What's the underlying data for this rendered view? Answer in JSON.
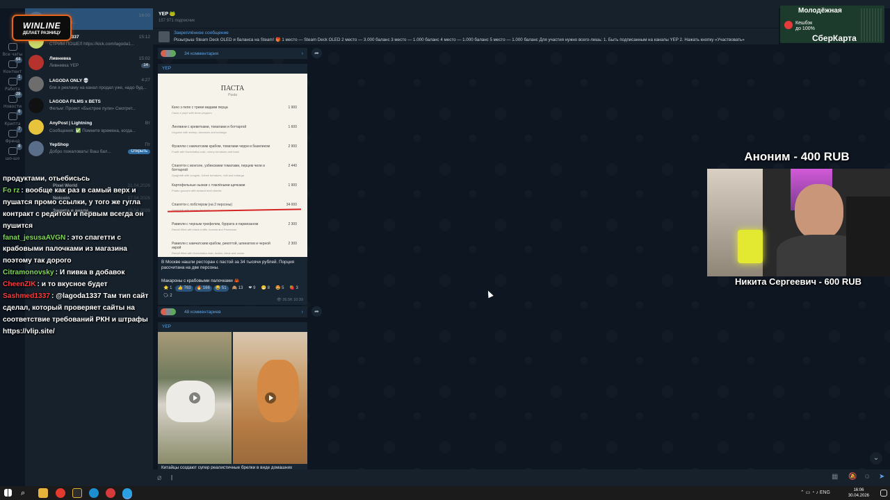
{
  "top_strip": {
    "bg": "#17212b"
  },
  "folders": [
    {
      "label": "Все чаты",
      "badge": ""
    },
    {
      "label": "Контент",
      "badge": "64"
    },
    {
      "label": "Работа",
      "badge": "1"
    },
    {
      "label": "Новости",
      "badge": "28"
    },
    {
      "label": "Крипта",
      "badge": "6"
    },
    {
      "label": "Френд",
      "badge": "7"
    },
    {
      "label": "шо-шо",
      "badge": "8"
    }
  ],
  "ad_logo": {
    "brand": "WINLINE",
    "slogan": "ДЕЛАЕТ РАЗНИЦУ"
  },
  "chats": [
    {
      "name": "",
      "preview": "Челленджи...",
      "time": "16:00",
      "badge": "",
      "active": true,
      "avatar_color": "#3d6fa0"
    },
    {
      "name": "LAGODA1337",
      "preview": "СТРИМ ПОШЕЛ https://kick.com/lagoda1...",
      "time": "15:12",
      "badge": "",
      "active": false,
      "avatar_color": "#c7d86a"
    },
    {
      "name": "Ливневка",
      "preview": "Ливневка YEP",
      "time": "15:02",
      "badge": "14",
      "active": false,
      "avatar_color": "#b5332c"
    },
    {
      "name": "LAGODA ONLY 💀",
      "preview": "бля я рекламу на канал продал уже, надо буд...",
      "time": "4:27",
      "badge": "",
      "active": false,
      "avatar_color": "#6d6d6d"
    },
    {
      "name": "LAGODA FILMS x BETS",
      "preview": "Фильм: Проект «Быстрее пули» Смотрет...",
      "time": "",
      "badge": "",
      "active": false,
      "avatar_color": "#111111"
    },
    {
      "name": "AnyPost | Lightning",
      "preview": "Сообщения: ✅ Помните времена, когда...",
      "time": "Вт",
      "badge": "",
      "active": false,
      "avatar_color": "#e8c43c"
    },
    {
      "name": "YepShop",
      "preview": "Добро пожаловать! Ваш бал...",
      "time": "Пт",
      "badge": "",
      "active": false,
      "avatar_color": "#5a6e8a",
      "open": "Открыть"
    }
  ],
  "chats_partial": [
    {
      "name": "Pixel World",
      "time": "21.04.2026"
    },
    {
      "name": "Notcoin",
      "time": "17.04.2026"
    },
    {
      "name": "Защита и анали...",
      "time": "15.04.2026"
    }
  ],
  "stream_chat": [
    {
      "user": "",
      "user_color": "#ffffff",
      "text": "продуктами, отьебисьсь"
    },
    {
      "user": "Fo rz",
      "user_color": "#7ed957",
      "text": "вообще как раз в самый верх и пушатся промо ссылки, у того же гугла контракт с редитом и первым всегда он пушится"
    },
    {
      "user": "fanat_jesusaAVGN",
      "user_color": "#7ed957",
      "text": "это спагетти с крабовыми палочками из магазина поэтому так дорого"
    },
    {
      "user": "Citramonovsky",
      "user_color": "#7ed957",
      "text": "И пивка в добавок"
    },
    {
      "user": "CheenZIK",
      "user_color": "#ff3b3b",
      "text": "и то вкусное будет"
    },
    {
      "user": "Sashmed1337",
      "user_color": "#ff3b3b",
      "text": "@lagoda1337 Там тип сайт сделал, который проверяет сайты на соответствие требований РКН и штрафы https://vlip.site/"
    }
  ],
  "channel": {
    "title": "YEP 🐸",
    "subscribers": "157 971 подписчик"
  },
  "pinned": {
    "title": "Закреплённое сообщение",
    "text": "Розыгрыш Steam Deck OLED и баланса на Steam! 🎁 1 место — Steam Deck OLED 2 место — 3.000 баланс 3 место — 1.000 баланс 4 место — 1.000 баланс 5 место — 1.000 баланс Для участия нужно всего-лишь: 1. Быть подписанным на каналы YEP 2. Нажать кнопку «Участвовать»"
  },
  "sber_ad": {
    "line1": "Молодёжная",
    "line2": "Кешбэк\nдо 100%",
    "line3": "СберКарта"
  },
  "comments_bar_1": "34 комментария",
  "comments_bar_2": "48 комментариев",
  "post1": {
    "channel": "YEP",
    "menu_title": "ПАСТА",
    "menu_subtitle": "Pasta",
    "menu_items": [
      {
        "ru": "Качо э пепе с тремя видами перца",
        "en": "Cacio e pepe with three peppers",
        "price": "1 900"
      },
      {
        "ru": "Лингвини с креветками, томатами и боттаргой",
        "en": "Linguine with shrimp, tomatoes and bottarga",
        "price": "1 600"
      },
      {
        "ru": "Фузилли с камчатским крабом, томатами черри и базиликом",
        "en": "Fusilli with Kamchatka crab, cherry tomatoes and basil",
        "price": "2 900"
      },
      {
        "ru": "Спагетти с вонголе, узбекскими томатами, перцем чили и боттаргой",
        "en": "Spaghetti with vongole, Uzbek tomatoes, chili and bottarga",
        "price": "2 440"
      },
      {
        "ru": "Картофельные ньокки с томлёными щечками",
        "en": "Potato gnocchi with braised beef cheeks",
        "price": "1 900"
      },
      {
        "ru": "Спагетти с лобстером (на 2 персоны)",
        "en": "Spaghetti with lobster (for two)",
        "price": "34 000"
      },
      {
        "ru": "Равиоли с черным трюфелем, буррата и пармезаном",
        "en": "Ravioli filled with black truffle, burrata and Parmesan",
        "price": "2 300"
      },
      {
        "ru": "Равиоли с камчатским крабом, рикоттой, шпинатом и черной икрой",
        "en": "Ravioli filled with Kamchatka crab, ricotta, citrus and caviar",
        "price": "2 300"
      }
    ],
    "caption": "В Москве нашли ресторан с пастой за 34 тысячи рублей. Порция рассчитана на две персоны.",
    "caption2": "Макароны с крабовыми палочками 🦀",
    "reactions": [
      "⭐ 1",
      "👍 763",
      "🔥 166",
      "😂 51",
      "🙈 13",
      "❤ 9",
      "😁 8",
      "🤩 5",
      "🍓 3",
      "🗣 2"
    ],
    "views": "26.5K",
    "time": "10:39"
  },
  "post2": {
    "channel": "YEP",
    "caption": "Китайцы создают супер реалистичные брелки в виде домашних"
  },
  "donations": {
    "top": "Аноним - 400 RUB",
    "bottom": "Никита Сергеевич - 600 RUB"
  },
  "taskbar": {
    "lang": "ENG",
    "time": "16:06",
    "date": "30.04.2026"
  }
}
